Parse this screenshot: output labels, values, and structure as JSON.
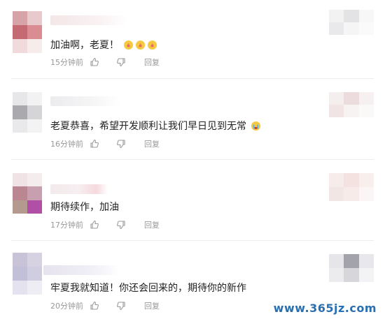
{
  "colors": {
    "text": "#222222",
    "meta": "#999999",
    "divider": "#eeeeee",
    "watermark": "#2a6fb0"
  },
  "comments": [
    {
      "text": "加油啊，老夏！",
      "time": "15分钟前",
      "reply_label": "回复",
      "emojis": [
        "praying-hands-emoji",
        "praying-hands-emoji",
        "praying-hands-emoji"
      ]
    },
    {
      "text": "老夏恭喜，希望开发顺利让我们早日见到无常",
      "time": "16分钟前",
      "reply_label": "回复",
      "emojis": [
        "crying-face-emoji"
      ]
    },
    {
      "text": "期待续作，加油",
      "time": "17分钟前",
      "reply_label": "回复",
      "emojis": []
    },
    {
      "text": "牢夏我就知道！你还会回来的，期待你的新作",
      "time": "20分钟前",
      "reply_label": "回复",
      "emojis": []
    }
  ],
  "watermark": "www.365jz.com"
}
